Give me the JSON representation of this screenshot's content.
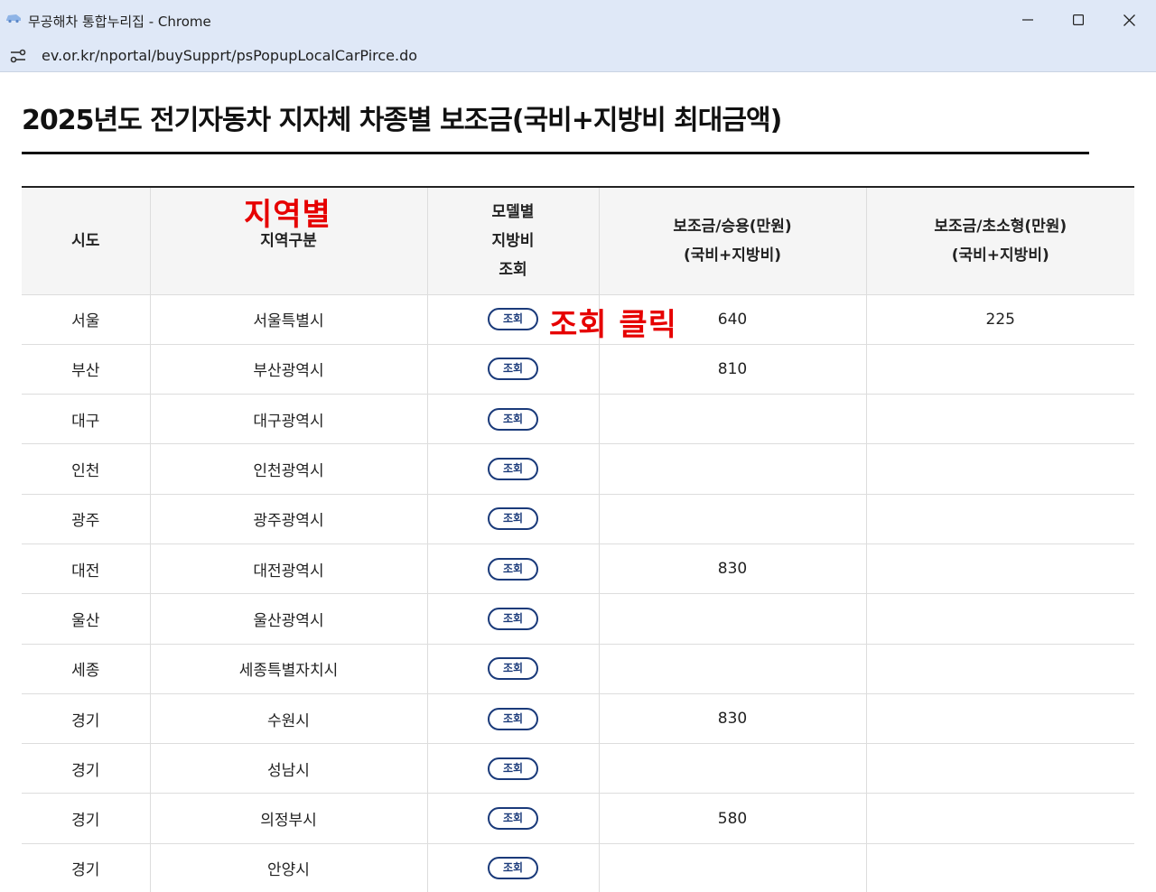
{
  "window": {
    "title": "무공해차 통합누리집 - Chrome",
    "url": "ev.or.kr/nportal/buySupprt/psPopupLocalCarPirce.do"
  },
  "page": {
    "title": "2025년도 전기자동차 지자체 차종별 보조금(국비+지방비 최대금액)"
  },
  "table": {
    "headers": {
      "sido": "시도",
      "region": "지역구분",
      "model_line1": "모델별",
      "model_line2": "지방비",
      "model_line3": "조회",
      "passenger_line1": "보조금/승용(만원)",
      "passenger_line2": "(국비+지방비)",
      "small_line1": "보조금/초소형(만원)",
      "small_line2": "(국비+지방비)"
    },
    "button_label": "조회",
    "rows": [
      {
        "sido": "서울",
        "region": "서울특별시",
        "passenger": "640",
        "small": "225"
      },
      {
        "sido": "부산",
        "region": "부산광역시",
        "passenger": "810",
        "small": ""
      },
      {
        "sido": "대구",
        "region": "대구광역시",
        "passenger": "",
        "small": ""
      },
      {
        "sido": "인천",
        "region": "인천광역시",
        "passenger": "",
        "small": ""
      },
      {
        "sido": "광주",
        "region": "광주광역시",
        "passenger": "",
        "small": ""
      },
      {
        "sido": "대전",
        "region": "대전광역시",
        "passenger": "830",
        "small": ""
      },
      {
        "sido": "울산",
        "region": "울산광역시",
        "passenger": "",
        "small": ""
      },
      {
        "sido": "세종",
        "region": "세종특별자치시",
        "passenger": "",
        "small": ""
      },
      {
        "sido": "경기",
        "region": "수원시",
        "passenger": "830",
        "small": ""
      },
      {
        "sido": "경기",
        "region": "성남시",
        "passenger": "",
        "small": ""
      },
      {
        "sido": "경기",
        "region": "의정부시",
        "passenger": "580",
        "small": ""
      },
      {
        "sido": "경기",
        "region": "안양시",
        "passenger": "",
        "small": ""
      }
    ]
  },
  "annotations": {
    "region": "지역별",
    "click": "조회 클릭"
  },
  "colors": {
    "titlebar": "#dfe8f7",
    "button_border": "#1a3a7a",
    "annotation": "#e60000"
  }
}
